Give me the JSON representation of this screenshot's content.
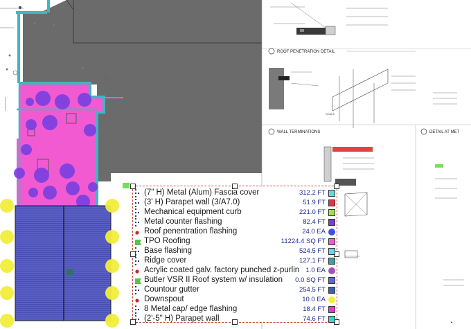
{
  "legend": {
    "items": [
      {
        "label": "(7\" H) Metal (Alum) Fascia cover",
        "qty": "312.2 FT",
        "swatch": "#6ad6d6",
        "shape": "square",
        "icon": "dotted-line"
      },
      {
        "label": "(3' H) Parapet wall (3/A7.0)",
        "qty": "51.9 FT",
        "swatch": "#e3334a",
        "shape": "square",
        "icon": "dotted-line"
      },
      {
        "label": "Mechanical equipment curb",
        "qty": "221.0 FT",
        "swatch": "#9ce05a",
        "shape": "square",
        "icon": "dotted-line"
      },
      {
        "label": "Metal counter flashing",
        "qty": "82.4 FT",
        "swatch": "#7a3fc4",
        "shape": "square",
        "icon": "dotted-line"
      },
      {
        "label": "Roof penentration flashing",
        "qty": "24.0 EA",
        "swatch": "#3f4fe0",
        "shape": "circle",
        "icon": "red-dot"
      },
      {
        "label": "TPO Roofing",
        "qty": "11224.4 SQ FT",
        "swatch": "#f25ad2",
        "shape": "square",
        "icon": "green-flag"
      },
      {
        "label": "Base flashing",
        "qty": "524.5 FT",
        "swatch": "#6ad6ea",
        "shape": "square",
        "icon": "dotted-line"
      },
      {
        "label": "Ridge cover",
        "qty": "127.1 FT",
        "swatch": "#3fa0a0",
        "shape": "square",
        "icon": "dotted-line"
      },
      {
        "label": "Acrylic coated galv. factory punched z-purlin",
        "qty": "1.0 EA",
        "swatch": "#a352b8",
        "shape": "circle",
        "icon": "red-dot"
      },
      {
        "label": "Butler VSR II Roof system w/ insulation",
        "qty": "0.0 SQ FT",
        "swatch": "#5a6ad6",
        "shape": "square",
        "icon": "green-flag"
      },
      {
        "label": "Countour gutter",
        "qty": "254.5 FT",
        "swatch": "#3f5fa8",
        "shape": "square",
        "icon": "dotted-line"
      },
      {
        "label": "Downspout",
        "qty": "10.0 EA",
        "swatch": "#f2ee3a",
        "shape": "circle",
        "icon": "red-dot"
      },
      {
        "label": "8 Metal cap/ edge flashing",
        "qty": "18.4 FT",
        "swatch": "#e43ad6",
        "shape": "square",
        "icon": "dotted-line"
      },
      {
        "label": "(2'-5\" H) Parapet wall",
        "qty": "74.6 FT",
        "swatch": "#3ad6c4",
        "shape": "square",
        "icon": "dotted-line"
      }
    ]
  },
  "details": {
    "roof_penetration": "ROOF PENETRATION DETAIL",
    "wall_terminations": "WALL TERMINATIONS",
    "detail_at": "DETAIL AT MET",
    "scale": "SCALE"
  },
  "colors": {
    "roof_gray": "#6b6b6b",
    "tpo_magenta": "#f25ad2",
    "butler_blue": "#5a5fc4",
    "outline_teal": "#3fb6c2",
    "penetration_purple": "#7a3fe0",
    "downspout_yellow": "#f2ee3a"
  }
}
